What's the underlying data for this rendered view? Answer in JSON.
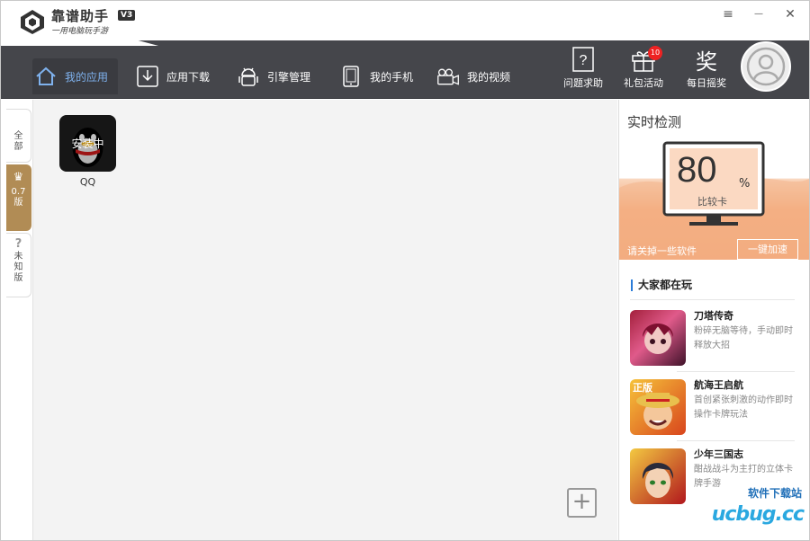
{
  "app": {
    "brand": "靠谱助手",
    "version": "V3",
    "slogan": "一用电脑玩手游"
  },
  "window_controls": {
    "menu": "≡",
    "minimize": "—",
    "close": "✕"
  },
  "nav": {
    "items": [
      {
        "label": "我的应用",
        "icon": "home-icon",
        "active": true
      },
      {
        "label": "应用下载",
        "icon": "download-icon"
      },
      {
        "label": "引擎管理",
        "icon": "android-icon"
      },
      {
        "label": "我的手机",
        "icon": "phone-icon"
      },
      {
        "label": "我的视频",
        "icon": "video-camera-icon"
      }
    ],
    "right": [
      {
        "label": "问题求助",
        "icon": "help-icon"
      },
      {
        "label": "礼包活动",
        "icon": "gift-icon",
        "badge": "10"
      },
      {
        "label": "每日摇奖",
        "icon": "lottery-icon"
      }
    ]
  },
  "left_tabs": [
    {
      "label": "全部"
    },
    {
      "label": "0.7版",
      "icon": "crown-icon"
    },
    {
      "label": "未知版",
      "icon": "question-icon"
    }
  ],
  "apps": [
    {
      "name": "QQ",
      "status": "安装中"
    }
  ],
  "add_button": "+",
  "right_panel": {
    "title": "实时检测",
    "score": "80",
    "unit": "%",
    "status": "比较卡",
    "tip": "请关掉一些软件",
    "speed_button": "一键加速",
    "hot_title": "大家都在玩",
    "games": [
      {
        "name": "刀塔传奇",
        "desc": "粉碎无脑等待，手动即时释放大招"
      },
      {
        "name": "航海王启航",
        "desc": "首创紧张刺激的动作即时操作卡牌玩法"
      },
      {
        "name": "少年三国志",
        "desc": "酣战战斗为主打的立体卡牌手游"
      }
    ]
  },
  "watermark": {
    "line1": "软件下载站",
    "line2": "ucbug.cc"
  },
  "colors": {
    "nav_bg": "#45464b",
    "accent": "#7fb2ee",
    "gold_tab": "#b18c55",
    "panel_orange": "#f29f6c",
    "badge": "#e22222"
  }
}
